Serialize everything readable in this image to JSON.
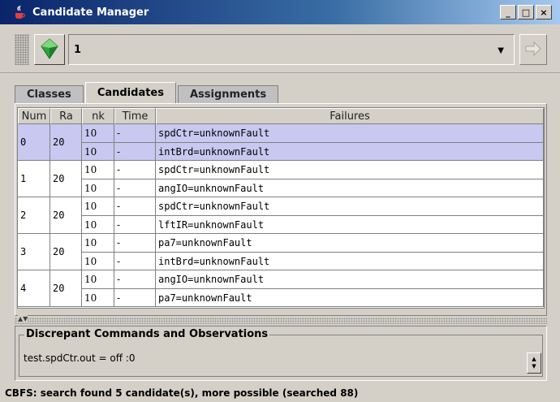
{
  "window": {
    "title": "Candidate Manager",
    "controls": [
      "_",
      "□",
      "×"
    ]
  },
  "toolbar": {
    "selected_value": "1",
    "left_icon": "green-gem-icon",
    "right_icon": "arrow-right-icon"
  },
  "tabs": [
    {
      "label": "Classes",
      "active": false
    },
    {
      "label": "Candidates",
      "active": true
    },
    {
      "label": "Assignments",
      "active": false
    }
  ],
  "table": {
    "headers": [
      "Num",
      "Ra",
      "nk",
      "Time",
      "Failures"
    ],
    "groups": [
      {
        "num": "0",
        "rank": "20",
        "selected": true,
        "rows": [
          {
            "nk": "10",
            "time": "-",
            "failure": "spdCtr=unknownFault"
          },
          {
            "nk": "10",
            "time": "-",
            "failure": "intBrd=unknownFault"
          }
        ]
      },
      {
        "num": "1",
        "rank": "20",
        "selected": false,
        "rows": [
          {
            "nk": "10",
            "time": "-",
            "failure": "spdCtr=unknownFault"
          },
          {
            "nk": "10",
            "time": "-",
            "failure": "angIO=unknownFault"
          }
        ]
      },
      {
        "num": "2",
        "rank": "20",
        "selected": false,
        "rows": [
          {
            "nk": "10",
            "time": "-",
            "failure": "spdCtr=unknownFault"
          },
          {
            "nk": "10",
            "time": "-",
            "failure": "lftIR=unknownFault"
          }
        ]
      },
      {
        "num": "3",
        "rank": "20",
        "selected": false,
        "rows": [
          {
            "nk": "10",
            "time": "-",
            "failure": "pa7=unknownFault"
          },
          {
            "nk": "10",
            "time": "-",
            "failure": "intBrd=unknownFault"
          }
        ]
      },
      {
        "num": "4",
        "rank": "20",
        "selected": false,
        "rows": [
          {
            "nk": "10",
            "time": "-",
            "failure": "angIO=unknownFault"
          },
          {
            "nk": "10",
            "time": "-",
            "failure": "pa7=unknownFault"
          }
        ]
      }
    ]
  },
  "discrepant": {
    "title": "Discrepant Commands and Observations",
    "value": "test.spdCtr.out = off :0"
  },
  "status": {
    "text": "CBFS: search found 5 candidate(s), more possible (searched 88)"
  },
  "colors": {
    "selected_row": "#c8c8f0",
    "title_bar": "#0a246a"
  }
}
